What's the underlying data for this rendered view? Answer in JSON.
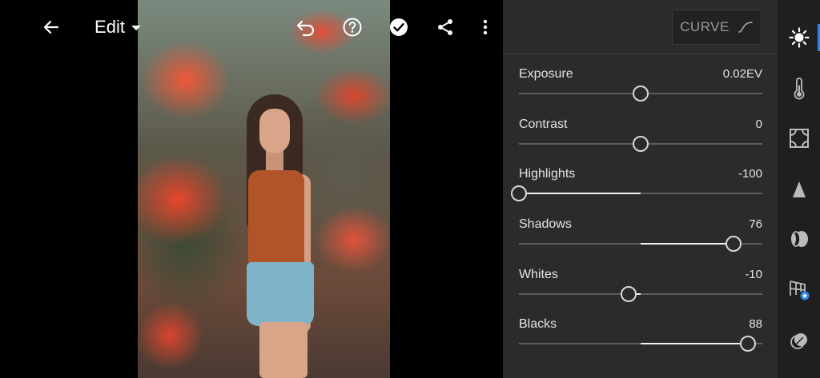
{
  "toolbar": {
    "edit_label": "Edit",
    "icons": [
      "arrow-left-icon",
      "caret-down-icon",
      "undo-icon",
      "help-icon",
      "checkmark-icon",
      "share-icon",
      "more-vertical-icon"
    ]
  },
  "panel": {
    "curve_label": "CURVE",
    "sliders": [
      {
        "label": "Exposure",
        "value": "0.02EV",
        "position": 0.5,
        "fill_from": 0.5,
        "fill_to": 0.5
      },
      {
        "label": "Contrast",
        "value": "0",
        "position": 0.5,
        "fill_from": 0.5,
        "fill_to": 0.5
      },
      {
        "label": "Highlights",
        "value": "-100",
        "position": 0.0,
        "fill_from": 0.0,
        "fill_to": 0.5
      },
      {
        "label": "Shadows",
        "value": "76",
        "position": 0.88,
        "fill_from": 0.5,
        "fill_to": 0.88
      },
      {
        "label": "Whites",
        "value": "-10",
        "position": 0.45,
        "fill_from": 0.45,
        "fill_to": 0.5
      },
      {
        "label": "Blacks",
        "value": "88",
        "position": 0.94,
        "fill_from": 0.5,
        "fill_to": 0.94
      }
    ]
  },
  "rail": {
    "items": [
      "light-icon",
      "color-temperature-icon",
      "effects-vignette-icon",
      "detail-icon",
      "optics-lens-icon",
      "geometry-icon",
      "masking-icon"
    ],
    "active_index": 0,
    "accent": "#2b86e8"
  }
}
